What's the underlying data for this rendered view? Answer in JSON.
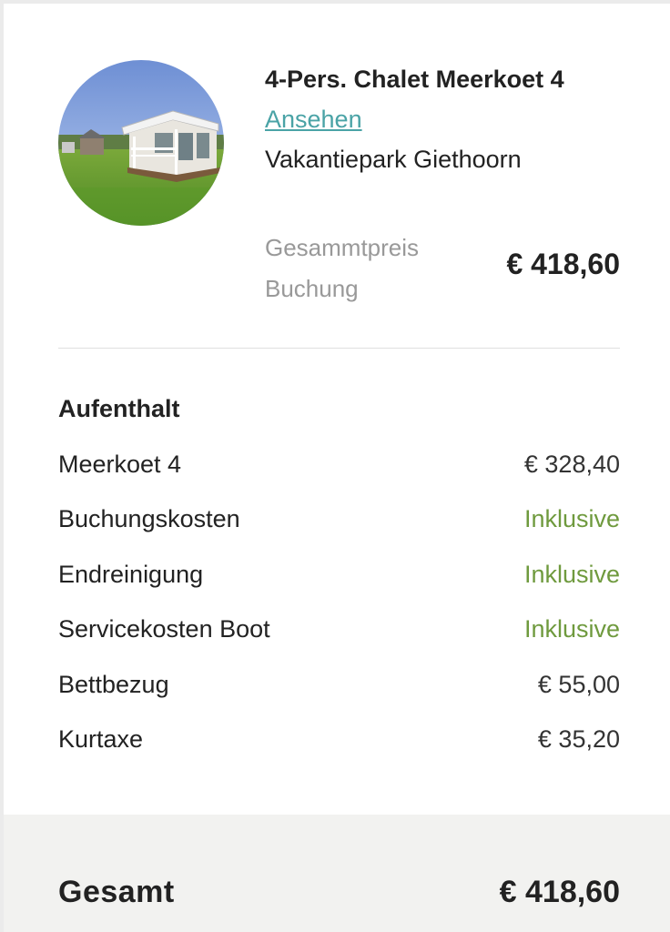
{
  "property": {
    "title": "4-Pers. Chalet Meerkoet 4",
    "view_link": "Ansehen",
    "park": "Vakantiepark Giethoorn",
    "total_label_line1": "Gesammtpreis",
    "total_label_line2": "Buchung",
    "total_value": "€ 418,60",
    "image_alt": "chalet-photo"
  },
  "stay": {
    "title": "Aufenthalt",
    "items": [
      {
        "label": "Meerkoet 4",
        "value": "€ 328,40",
        "included": false
      },
      {
        "label": "Buchungskosten",
        "value": "Inklusive",
        "included": true
      },
      {
        "label": "Endreinigung",
        "value": "Inklusive",
        "included": true
      },
      {
        "label": "Servicekosten Boot",
        "value": "Inklusive",
        "included": true
      },
      {
        "label": "Bettbezug",
        "value": "€ 55,00",
        "included": false
      },
      {
        "label": "Kurtaxe",
        "value": "€ 35,20",
        "included": false
      }
    ]
  },
  "footer": {
    "label": "Gesamt",
    "value": "€ 418,60"
  },
  "colors": {
    "link": "#4aa3a6",
    "included": "#6f9a3e",
    "muted": "#999999",
    "footer_bg": "#f2f2f0"
  }
}
